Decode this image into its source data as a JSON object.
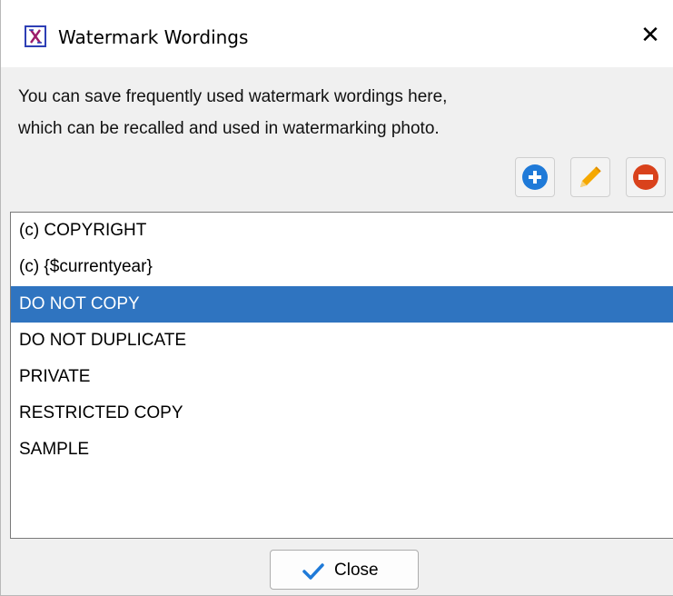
{
  "window": {
    "title": "Watermark Wordings",
    "app_icon": "x-logo-icon",
    "close_glyph": "✕"
  },
  "description": {
    "line1": "You can save frequently used watermark wordings here,",
    "line2": "which can be recalled and used in watermarking photo."
  },
  "toolbar": {
    "add_icon": "plus-circle-icon",
    "edit_icon": "pencil-icon",
    "remove_icon": "minus-circle-icon",
    "add_color": "#1f7ad8",
    "edit_color": "#f5a800",
    "remove_color": "#d9421c"
  },
  "list": {
    "items": [
      "(c) COPYRIGHT",
      "(c) {$currentyear}",
      "DO NOT COPY",
      "DO NOT DUPLICATE",
      "PRIVATE",
      "RESTRICTED COPY",
      "SAMPLE"
    ],
    "selected": "DO NOT COPY",
    "selection_color": "#2f74c0"
  },
  "footer": {
    "close_label": "Close",
    "close_icon": "checkmark-icon"
  }
}
